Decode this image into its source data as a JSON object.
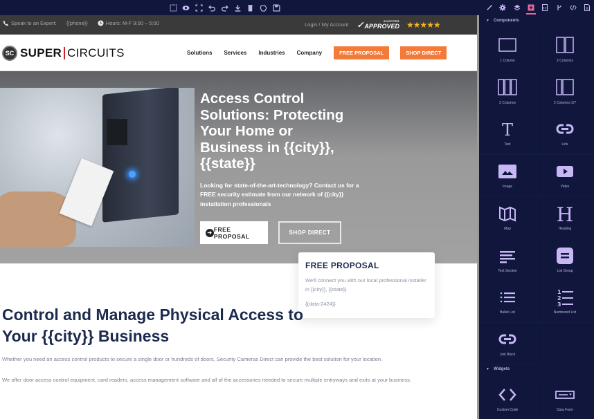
{
  "toolbar": {
    "tools": [
      {
        "icon": "select-box-icon",
        "label": "Select"
      },
      {
        "icon": "eye-icon",
        "label": "Preview"
      },
      {
        "icon": "fullscreen-icon",
        "label": "Fullscreen"
      },
      {
        "icon": "undo-icon",
        "label": "Undo"
      },
      {
        "icon": "redo-icon",
        "label": "Redo"
      },
      {
        "icon": "download-icon",
        "label": "Export"
      },
      {
        "icon": "trash-icon",
        "label": "Clear"
      },
      {
        "icon": "shape-icon",
        "label": "Shape"
      },
      {
        "icon": "save-icon",
        "label": "Save"
      }
    ]
  },
  "site": {
    "utility": {
      "speak_label": "Speak to an Expert:",
      "phone": "{{phone}}",
      "hours": "Hours: M-F 9:00 – 5:00",
      "login": "Login / My Account",
      "shopper_small": "SHOPPER",
      "shopper_big": "APPROVED",
      "stars": "★★★★★",
      "rating": 4.8
    },
    "logo": {
      "badge": "SC",
      "super": "SUPER",
      "circuits": "CIRCUITS"
    },
    "nav": {
      "items": [
        "Solutions",
        "Services",
        "Industries",
        "Company"
      ],
      "btn_proposal": "FREE PROPOSAL",
      "btn_shop": "SHOP DIRECT"
    },
    "hero": {
      "title": "Access Control Solutions: Protecting Your Home or Business in {{city}}, {{state}}",
      "subtitle": "Looking for state-of-the-art-technology? Contact us for a FREE security estimate from our network of {{city}} installation professionals",
      "btn_proposal": "FREE PROPOSAL",
      "btn_arrow": "➜",
      "btn_shop": "SHOP DIRECT"
    },
    "proposal_card": {
      "title": "FREE PROPOSAL",
      "text": "We'll connect you with our local professional installer in {{city}}, {{state}}",
      "data": "{{data-2424}}"
    },
    "section": {
      "title": "Control and Manage Physical Access to Your {{city}} Business",
      "p1": "Whether you need an access control products to secure a single door or hundreds of doors, Security Cameras Direct can provide the best solution for your location.",
      "p2": "We offer door access control equipment, card readers, access management software and all of the accessories needed to secure multiple entryways and exits at your business."
    }
  },
  "panel": {
    "tabs": [
      {
        "icon": "brush-icon",
        "label": "Style Manager"
      },
      {
        "icon": "gear-icon",
        "label": "Settings"
      },
      {
        "icon": "layers-icon",
        "label": "Layers"
      },
      {
        "icon": "add-block-icon",
        "label": "Blocks",
        "active": true
      },
      {
        "icon": "page-code-icon",
        "label": "Pages"
      },
      {
        "icon": "branch-icon",
        "label": "Version"
      },
      {
        "icon": "code-icon",
        "label": "Code"
      },
      {
        "icon": "document-icon",
        "label": "Document"
      }
    ],
    "components_header": "Components",
    "components": [
      {
        "label": "1 Column",
        "icon": "one-column-icon"
      },
      {
        "label": "2 Columns",
        "icon": "two-columns-icon"
      },
      {
        "label": "3 Columns",
        "icon": "three-columns-icon"
      },
      {
        "label": "2 Columns 3/7",
        "icon": "two-columns-37-icon"
      },
      {
        "label": "Text",
        "icon": "text-icon"
      },
      {
        "label": "Link",
        "icon": "link-icon"
      },
      {
        "label": "Image",
        "icon": "image-icon"
      },
      {
        "label": "Video",
        "icon": "video-icon"
      },
      {
        "label": "Map",
        "icon": "map-icon"
      },
      {
        "label": "Heading",
        "icon": "heading-icon"
      },
      {
        "label": "Text Section",
        "icon": "text-section-icon"
      },
      {
        "label": "List Group",
        "icon": "list-group-icon"
      },
      {
        "label": "Bullet List",
        "icon": "bullet-list-icon"
      },
      {
        "label": "Numbered List",
        "icon": "numbered-list-icon"
      },
      {
        "label": "Link Block",
        "icon": "link-block-icon"
      }
    ],
    "widgets_header": "Widgets",
    "widgets": [
      {
        "label": "Custom Code",
        "icon": "custom-code-icon"
      },
      {
        "label": "Data Form",
        "icon": "data-form-icon"
      }
    ],
    "colors": {
      "panel_bg": "#10163c",
      "icon": "#c7b8f5",
      "accent": "#e56a9b",
      "orange": "#f47a3a",
      "heading": "#1b2a4e"
    }
  }
}
